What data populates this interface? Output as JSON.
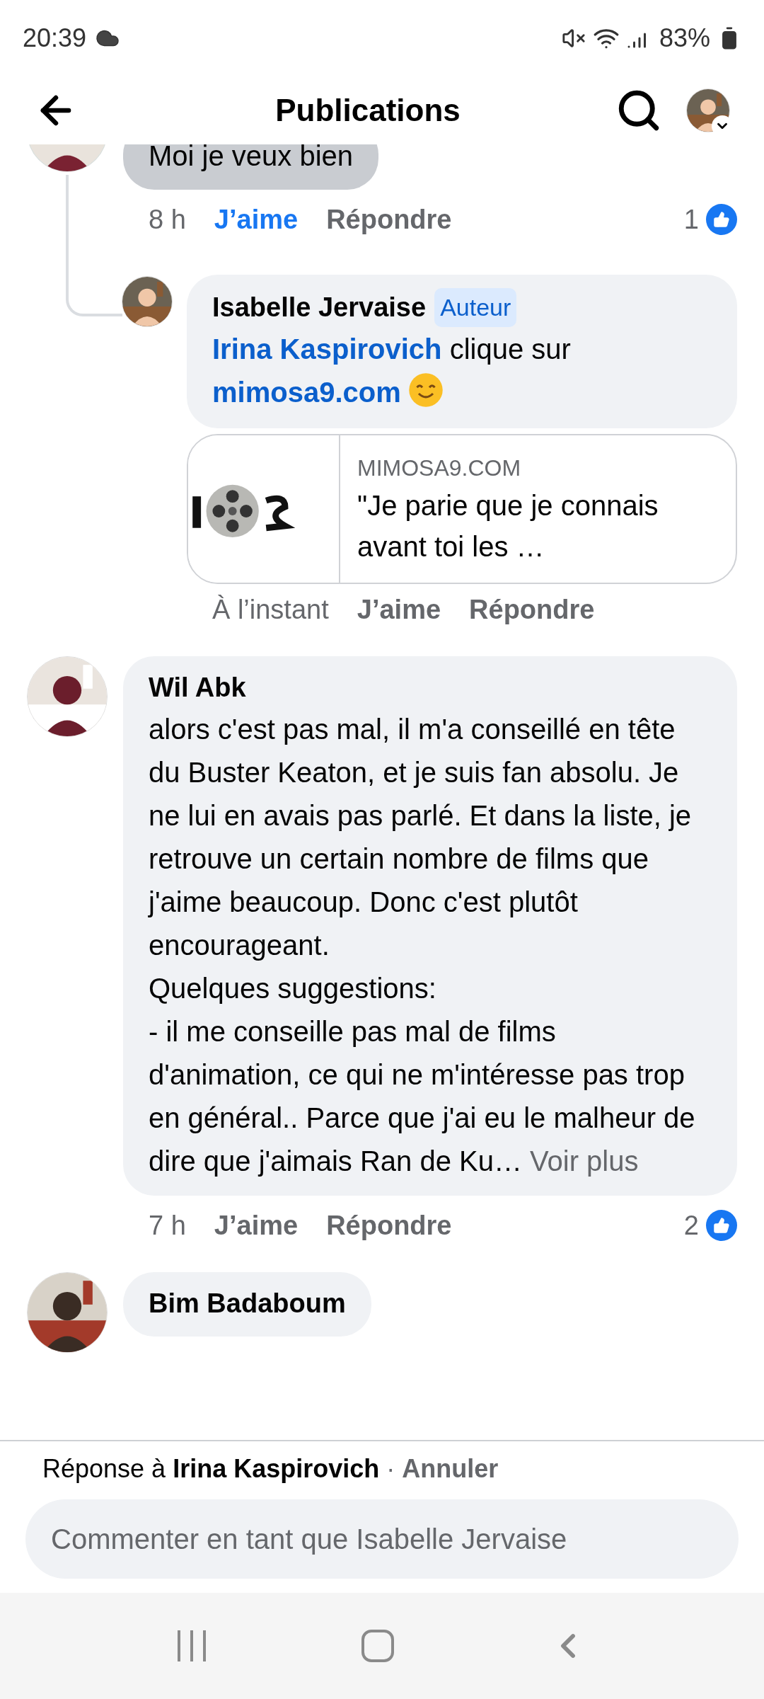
{
  "status_bar": {
    "time": "20:39",
    "battery": "83%"
  },
  "header": {
    "title": "Publications"
  },
  "comments": [
    {
      "text": "Moi je veux bien",
      "time": "8 h",
      "like_label": "J’aime",
      "liked": true,
      "reply_label": "Répondre",
      "like_count": "1",
      "replies": [
        {
          "author": "Isabelle Jervaise",
          "badge": "Auteur",
          "segments": [
            {
              "kind": "mention",
              "text": "Irina Kaspirovich"
            },
            {
              "kind": "plain",
              "text": " clique sur "
            },
            {
              "kind": "link",
              "text": "mimosa9.com"
            },
            {
              "kind": "emoji"
            }
          ],
          "link_preview": {
            "domain": "MIMOSA9.COM",
            "title": "\"Je parie que je connais avant toi les …"
          },
          "time": "À l’instant",
          "like_label": "J’aime",
          "liked": false,
          "reply_label": "Répondre"
        }
      ]
    },
    {
      "author": "Wil Abk",
      "paragraphs": [
        "alors c'est pas mal, il m'a conseillé en tête du Buster Keaton, et je suis fan absolu. Je ne lui en avais pas parlé. Et dans la liste, je retrouve un certain nombre de films que j'aime beaucoup. Donc c'est plutôt encourageant.",
        "Quelques suggestions:",
        "- il me conseille pas mal de films d'animation, ce qui ne m'intéresse pas trop en général.. Parce que j'ai eu le malheur de dire que j'aimais Ran de Ku…"
      ],
      "more": "Voir plus",
      "time": "7 h",
      "like_label": "J’aime",
      "liked": false,
      "reply_label": "Répondre",
      "like_count": "2"
    },
    {
      "author": "Bim Badaboum"
    }
  ],
  "composer": {
    "prefix": "Réponse à",
    "name": "Irina Kaspirovich",
    "separator": "·",
    "cancel": "Annuler",
    "placeholder": "Commenter en tant que Isabelle Jervaise"
  }
}
